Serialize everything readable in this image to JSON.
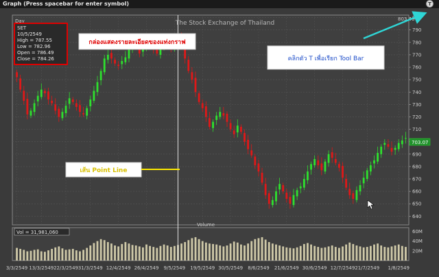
{
  "window": {
    "title": "Graph (Press spacebar for enter symbol)",
    "t_button_label": "T"
  },
  "chart_header": {
    "period": "Day",
    "exchange": "The Stock Exchange of Thailand",
    "top_value_readout": "803.46"
  },
  "info_box": {
    "symbol": "SET",
    "date": "10/5/2549",
    "high": "High  = 787.55",
    "low": "Low  = 782.96",
    "open": "Open = 786.49",
    "close": "Close = 784.26"
  },
  "annotations": {
    "info_box_callout": "กล่องแสดงรายละเอียดของแท่งกราฟ",
    "toolbar_callout": "คลิกตัว T เพื่อเรียก Tool Bar",
    "point_line_callout": "เส้น Point Line"
  },
  "volume_panel": {
    "title": "Volume",
    "readout": "Vol = 31,981,060",
    "axis_labels": [
      "60M",
      "40M",
      "20M"
    ]
  },
  "last_price_label": "703.07",
  "colors": {
    "background": "#3a3a3a",
    "up": "#2ee02e",
    "down": "#e01818",
    "grid": "#555555",
    "callout_red": "#e00000",
    "callout_yellow": "#ffeb00",
    "arrow_cyan": "#2fd6d6"
  },
  "chart_data": {
    "type": "candlestick",
    "y_ticks": [
      640,
      650,
      660,
      670,
      680,
      690,
      700,
      710,
      720,
      730,
      740,
      750,
      760,
      770,
      780,
      790,
      800
    ],
    "ylim": [
      633,
      802
    ],
    "x_tick_labels": [
      "3/3/2549",
      "13/3/2549",
      "22/3/2549",
      "31/3/2549",
      "12/4/2549",
      "26/4/2549",
      "9/5/2549",
      "19/5/2549",
      "30/5/2549",
      "8/6/2549",
      "21/6/2549",
      "30/6/2549",
      "12/7/2549",
      "21/7/2549",
      "1/8/2549"
    ],
    "x_tick_bar_index": [
      0,
      7,
      14,
      21,
      29,
      37,
      45,
      53,
      61,
      69,
      77,
      85,
      93,
      100,
      109
    ],
    "crosshair_bar_index": 46,
    "closes": [
      752,
      742,
      733,
      722,
      725,
      731,
      737,
      742,
      739,
      734,
      731,
      725,
      720,
      724,
      729,
      735,
      732,
      728,
      724,
      722,
      727,
      734,
      741,
      748,
      757,
      767,
      770,
      767,
      763,
      761,
      765,
      768,
      774,
      779,
      776,
      771,
      776,
      781,
      779,
      775,
      771,
      776,
      780,
      779,
      775,
      782,
      784,
      777,
      767,
      757,
      750,
      740,
      732,
      727,
      720,
      712,
      716,
      721,
      724,
      721,
      716,
      710,
      706,
      713,
      708,
      700,
      694,
      689,
      681,
      676,
      667,
      657,
      650,
      653,
      660,
      666,
      660,
      654,
      650,
      657,
      661,
      664,
      670,
      676,
      682,
      686,
      681,
      677,
      684,
      690,
      687,
      683,
      679,
      671,
      663,
      657,
      654,
      661,
      665,
      671,
      677,
      681,
      685,
      691,
      696,
      699,
      696,
      692,
      695,
      699,
      701,
      703
    ],
    "volume_millions": [
      26,
      24,
      22,
      19,
      20,
      22,
      23,
      19,
      18,
      21,
      24,
      27,
      29,
      25,
      22,
      23,
      24,
      21,
      19,
      22,
      26,
      31,
      36,
      40,
      44,
      42,
      38,
      35,
      31,
      29,
      34,
      38,
      35,
      32,
      31,
      29,
      27,
      33,
      30,
      28,
      26,
      30,
      33,
      31,
      28,
      30,
      32,
      35,
      38,
      42,
      46,
      48,
      44,
      40,
      37,
      35,
      34,
      33,
      31,
      29,
      31,
      35,
      39,
      37,
      33,
      31,
      35,
      40,
      44,
      46,
      48,
      43,
      38,
      35,
      33,
      31,
      29,
      27,
      26,
      25,
      27,
      30,
      34,
      36,
      33,
      30,
      28,
      26,
      27,
      29,
      31,
      28,
      26,
      29,
      33,
      37,
      34,
      31,
      29,
      27,
      28,
      30,
      33,
      35,
      31,
      28,
      27,
      29,
      31,
      33,
      30,
      28
    ],
    "volume_ylim": [
      0,
      62
    ]
  }
}
